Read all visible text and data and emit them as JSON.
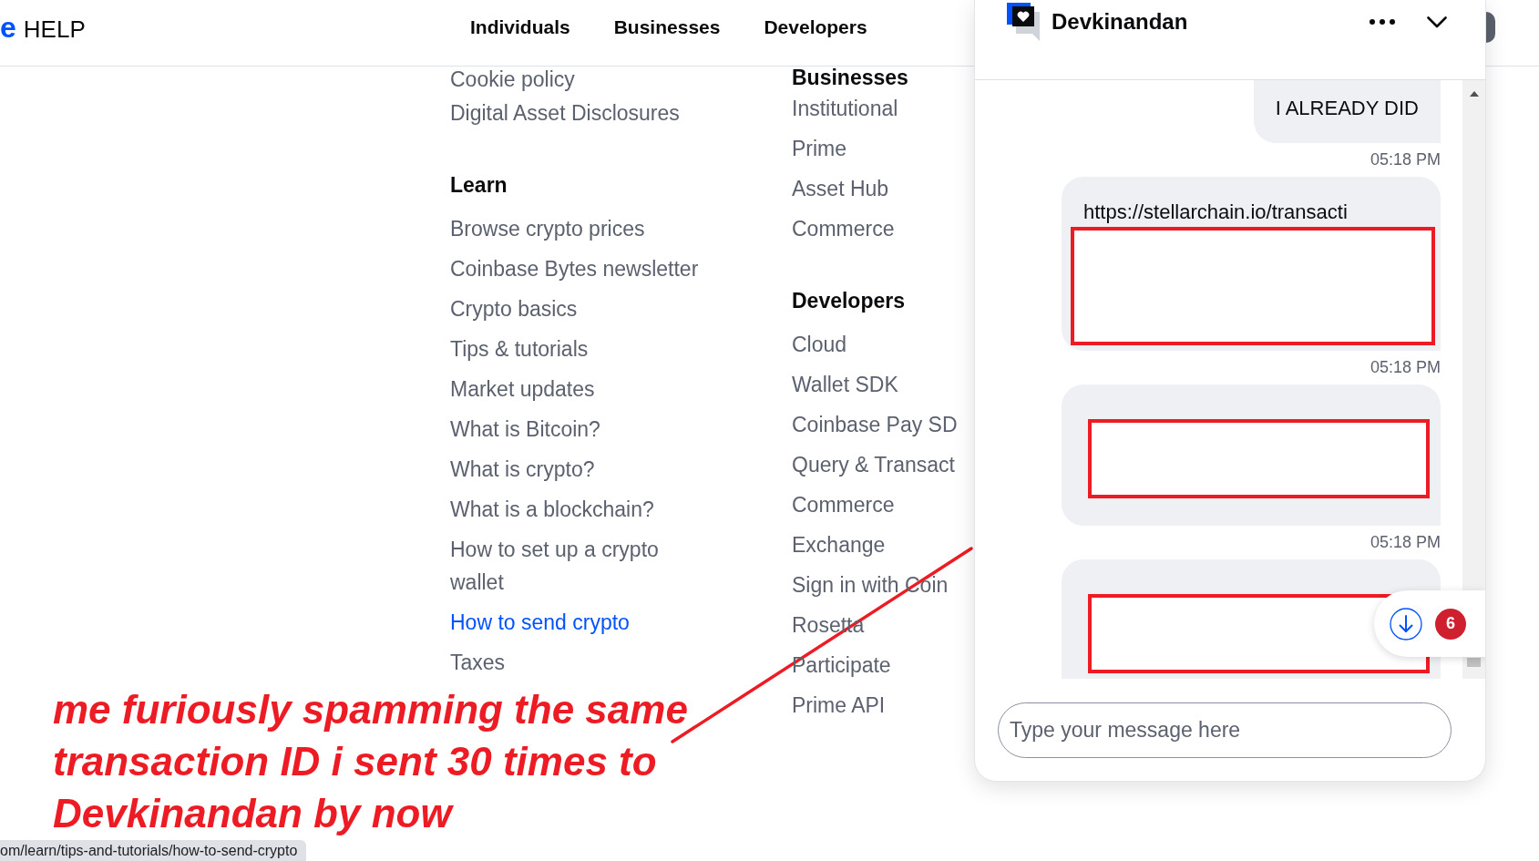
{
  "header": {
    "logo_fragment": "e",
    "title": "HELP",
    "nav": [
      "Individuals",
      "Businesses",
      "Developers"
    ]
  },
  "footer_columns": [
    {
      "sections": [
        {
          "links": [
            {
              "label": "Cookie policy",
              "hovered": false
            },
            {
              "label": "Digital Asset Disclosures",
              "hovered": false
            }
          ]
        },
        {
          "heading": "Learn",
          "links": [
            {
              "label": "Browse crypto prices",
              "hovered": false
            },
            {
              "label": "Coinbase Bytes newsletter",
              "hovered": false
            },
            {
              "label": "Crypto basics",
              "hovered": false
            },
            {
              "label": "Tips & tutorials",
              "hovered": false
            },
            {
              "label": "Market updates",
              "hovered": false
            },
            {
              "label": "What is Bitcoin?",
              "hovered": false
            },
            {
              "label": "What is crypto?",
              "hovered": false
            },
            {
              "label": "What is a blockchain?",
              "hovered": false
            },
            {
              "label": "How to set up a crypto wallet",
              "hovered": false
            },
            {
              "label": "How to send crypto",
              "hovered": true
            },
            {
              "label": "Taxes",
              "hovered": false
            }
          ]
        }
      ]
    },
    {
      "sections": [
        {
          "heading": "Businesses",
          "links": [
            {
              "label": "Institutional",
              "hovered": false
            },
            {
              "label": "Prime",
              "hovered": false
            },
            {
              "label": "Asset Hub",
              "hovered": false
            },
            {
              "label": "Commerce",
              "hovered": false
            }
          ]
        },
        {
          "heading": "Developers",
          "links": [
            {
              "label": "Cloud",
              "hovered": false
            },
            {
              "label": "Wallet SDK",
              "hovered": false
            },
            {
              "label": "Coinbase Pay SD",
              "hovered": false
            },
            {
              "label": "Query & Transact",
              "hovered": false
            },
            {
              "label": "Commerce",
              "hovered": false
            },
            {
              "label": "Exchange",
              "hovered": false
            },
            {
              "label": "Sign in with Coin",
              "hovered": false
            },
            {
              "label": "Rosetta",
              "hovered": false
            },
            {
              "label": "Participate",
              "hovered": false
            },
            {
              "label": "Prime API",
              "hovered": false
            }
          ]
        }
      ]
    }
  ],
  "chat": {
    "title": "Devkinandan",
    "messages": [
      {
        "kind": "text",
        "text": "I ALREADY DID",
        "time": "05:18 PM"
      },
      {
        "kind": "redacted",
        "text": "https://stellarchain.io/transacti",
        "time": "05:18 PM"
      },
      {
        "kind": "redacted",
        "time": "05:18 PM"
      },
      {
        "kind": "redacted"
      }
    ],
    "unread_count": "6",
    "input": {
      "placeholder": "Type your message here"
    }
  },
  "meme_caption": "me furiously spamming the same transaction ID i sent 30 times to Devkinandan by now",
  "status_url": "om/learn/tips-and-tutorials/how-to-send-crypto"
}
